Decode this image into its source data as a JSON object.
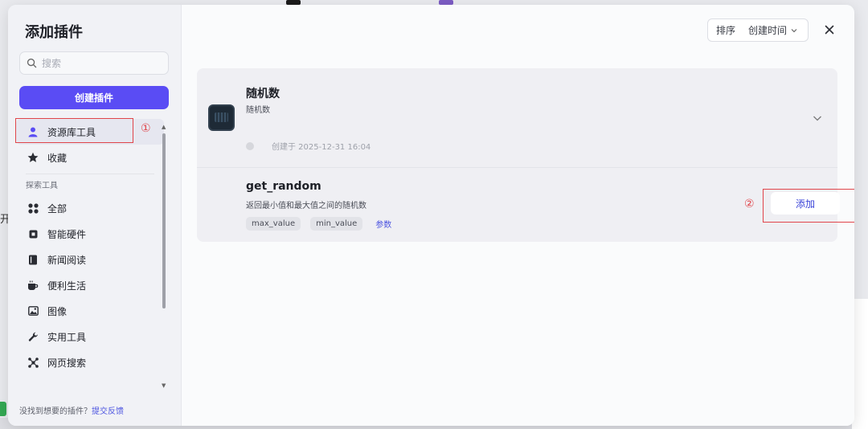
{
  "modal": {
    "title": "添加插件"
  },
  "sidebar": {
    "search_placeholder": "搜索",
    "create_button": "创建插件",
    "items": [
      {
        "label": "资源库工具",
        "icon": "user-icon",
        "active": true
      },
      {
        "label": "收藏",
        "icon": "star-icon"
      }
    ],
    "section_label": "探索工具",
    "explore_items": [
      {
        "label": "全部",
        "icon": "grid-icon"
      },
      {
        "label": "智能硬件",
        "icon": "chip-icon"
      },
      {
        "label": "新闻阅读",
        "icon": "book-icon"
      },
      {
        "label": "便利生活",
        "icon": "cup-icon"
      },
      {
        "label": "图像",
        "icon": "image-icon"
      },
      {
        "label": "实用工具",
        "icon": "wrench-icon"
      },
      {
        "label": "网页搜索",
        "icon": "network-icon"
      }
    ],
    "footer_text": "没找到想要的插件？",
    "footer_link": "提交反馈"
  },
  "annotations": {
    "marker_1": "①",
    "marker_2": "②",
    "color": "#e0454a"
  },
  "sort": {
    "label": "排序",
    "value": "创建时间"
  },
  "plugin": {
    "name": "随机数",
    "description": "随机数",
    "created": "创建于 2025-12-31 16:04"
  },
  "tool": {
    "name": "get_random",
    "description": "返回最小值和最大值之间的随机数",
    "params": [
      "max_value",
      "min_value"
    ],
    "params_link": "参数",
    "add_button": "添加"
  },
  "colors": {
    "primary": "#5a4cf4",
    "link": "#4d55e0"
  }
}
